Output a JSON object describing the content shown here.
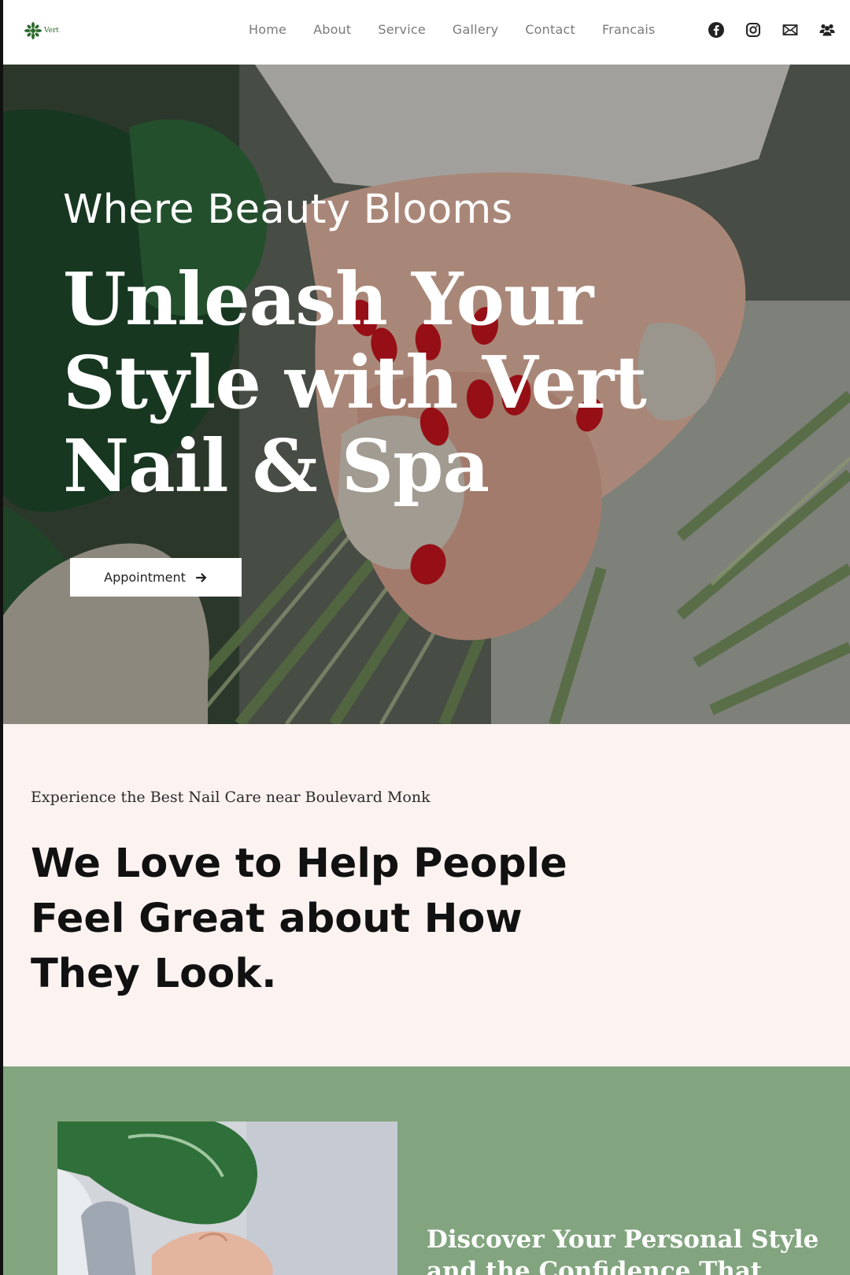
{
  "brand": {
    "logo_text": "Vert",
    "colors": {
      "accent_green": "#82a57f",
      "cream": "#fcf3f1",
      "nail_red": "#c8141e"
    }
  },
  "nav": {
    "links": [
      {
        "label": "Home"
      },
      {
        "label": "About"
      },
      {
        "label": "Service"
      },
      {
        "label": "Gallery"
      },
      {
        "label": "Contact"
      },
      {
        "label": "Francais"
      }
    ],
    "icons": [
      "facebook-icon",
      "instagram-icon",
      "mail-icon",
      "group-icon"
    ]
  },
  "hero": {
    "eyebrow": "Where Beauty Blooms",
    "title": "Unleash Your Style with Vert Nail & Spa",
    "cta_label": "Appointment",
    "cta_icon": "arrow-right-icon"
  },
  "intro": {
    "kicker": "Experience the Best Nail Care near Boulevard Monk",
    "heading": "We Love to Help People Feel Great about How They Look."
  },
  "feature": {
    "heading": "Discover Your Personal Style and the Confidence That Comes with"
  }
}
